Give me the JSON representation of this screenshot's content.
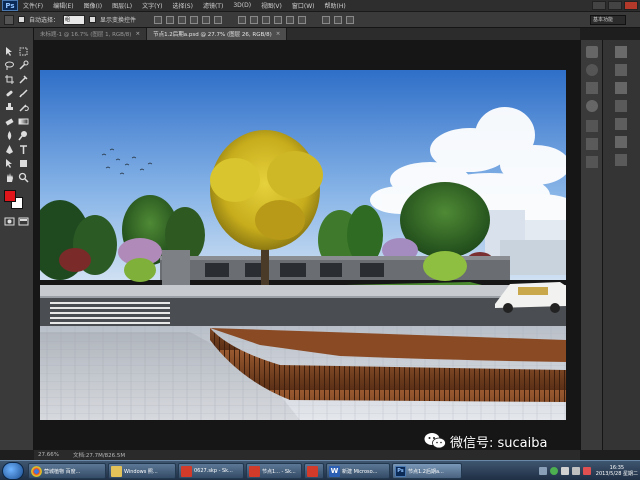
{
  "app": {
    "logo": "Ps"
  },
  "menu": {
    "items": [
      "文件(F)",
      "编辑(E)",
      "图像(I)",
      "图层(L)",
      "文字(Y)",
      "选择(S)",
      "滤镜(T)",
      "3D(D)",
      "视图(V)",
      "窗口(W)",
      "帮助(H)"
    ]
  },
  "options": {
    "auto_select_label": "自动选择：",
    "auto_select_value": "组",
    "transform_label": "显示变换控件",
    "workspace": "基本功能"
  },
  "tabs": [
    {
      "label": "未标题-1 @ 16.7% (图层 1, RGB/8)",
      "active": false
    },
    {
      "label": "节点1.2后期a.psd @ 27.7% (图层 26, RGB/8)",
      "active": true
    }
  ],
  "status": {
    "zoom": "27.66%",
    "doc_size": "文档:27.7M/826.5M"
  },
  "watermark": {
    "text": "微信号: sucaiba"
  },
  "taskbar": {
    "items": [
      {
        "label": "营城植物 百度...",
        "icon": "chrome-icon"
      },
      {
        "label": "Windows 照...",
        "icon": "folder-icon"
      },
      {
        "label": "0627.skp - Sk...",
        "icon": "sketchup-icon"
      },
      {
        "label": "节点1... - Sk...",
        "icon": "sketchup-icon"
      },
      {
        "label": "节点1.2... - Sk",
        "icon": "sketchup-icon"
      },
      {
        "label": "新建 Microso...",
        "icon": "word-icon"
      },
      {
        "label": "节点1.2后期a...",
        "icon": "photoshop-icon"
      }
    ],
    "clock_time": "16:35",
    "clock_date": "2013/5/28 星期二"
  },
  "colors": {
    "foreground": "#e0151b",
    "background": "#ffffff",
    "sky_top": "#3b7cd0",
    "taskbar": "#2b3f57"
  }
}
